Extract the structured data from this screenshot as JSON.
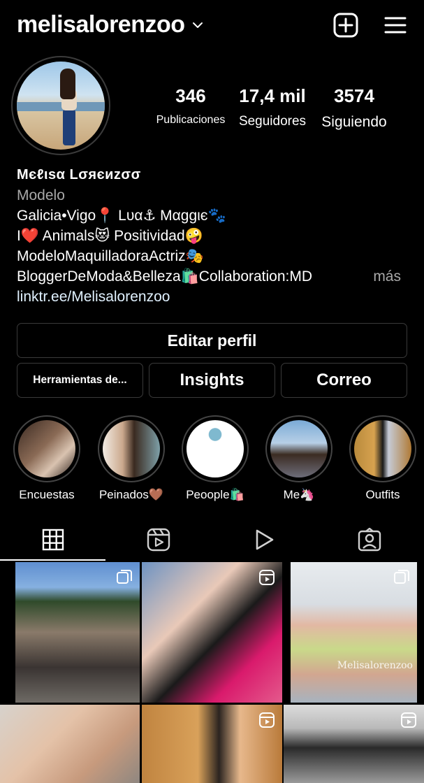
{
  "header": {
    "username": "melisalorenzoo",
    "icons": [
      "chevron-down-icon",
      "new-post-icon",
      "menu-icon"
    ]
  },
  "stats": {
    "posts": {
      "value": "346",
      "label": "Publicaciones"
    },
    "followers": {
      "value": "17,4 mil",
      "label": "Seguidores"
    },
    "following": {
      "value": "3574",
      "label": "Siguiendo"
    }
  },
  "bio": {
    "name": "Mєℓιѕα Lσяєиzσσ",
    "category": "Modelo",
    "lines": [
      "Galicia•Vigo📍 Lυα⚓ Mαggιє🐾",
      "I❤️ Animals😻 Positividad🤪",
      "ModeloMaquilladoraActriz🎭",
      "BloggerDeModa&Belleza🛍️Collaboration:MD"
    ],
    "more": "más",
    "link": "linktr.ee/Melisalorenzoo"
  },
  "buttons": {
    "edit": "Editar perfil",
    "tools": "Herramientas de...",
    "insights": "Insights",
    "email": "Correo"
  },
  "highlights": [
    {
      "label": "Encuestas"
    },
    {
      "label": "Peinados🤎"
    },
    {
      "label": "Peoople🛍️"
    },
    {
      "label": "Me🦄"
    },
    {
      "label": "Outfits"
    }
  ],
  "tabs": [
    {
      "name": "grid-icon",
      "active": true
    },
    {
      "name": "reels-icon",
      "active": false
    },
    {
      "name": "play-icon",
      "active": false
    },
    {
      "name": "tagged-icon",
      "active": false
    }
  ],
  "posts": [
    {
      "badge": "carousel-icon"
    },
    {
      "badge": "reel-icon"
    },
    {
      "badge": "carousel-icon",
      "watermark": "Melisalorenzoo"
    },
    {
      "badge": ""
    },
    {
      "badge": "reel-icon"
    },
    {
      "badge": "reel-icon"
    }
  ],
  "colors": {
    "background": "#000000",
    "border": "#3a3a3a",
    "secondary_text": "#a8a8a8",
    "link": "#e0f1ff"
  }
}
